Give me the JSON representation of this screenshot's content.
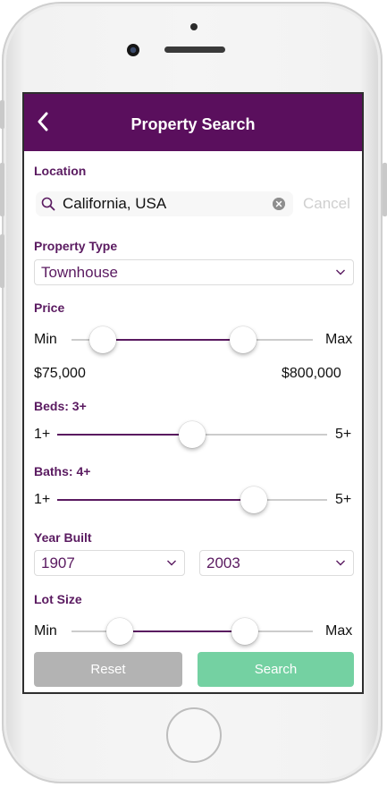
{
  "header": {
    "title": "Property Search"
  },
  "location": {
    "label": "Location",
    "value": "California, USA",
    "cancel": "Cancel"
  },
  "property_type": {
    "label": "Property Type",
    "value": "Townhouse"
  },
  "price": {
    "label": "Price",
    "min_label": "Min",
    "max_label": "Max",
    "min_value": "$75,000",
    "max_value": "$800,000",
    "range_fraction": [
      0.13,
      0.71
    ]
  },
  "beds": {
    "label": "Beds: 3+",
    "min_label": "1+",
    "max_label": "5+",
    "fraction": 0.5
  },
  "baths": {
    "label": "Baths: 4+",
    "min_label": "1+",
    "max_label": "5+",
    "fraction": 0.73
  },
  "year_built": {
    "label": "Year Built",
    "from": "1907",
    "to": "2003"
  },
  "lot_size": {
    "label": "Lot Size",
    "min_label": "Min",
    "max_label": "Max",
    "range_fraction": [
      0.2,
      0.72
    ]
  },
  "actions": {
    "reset": "Reset",
    "search": "Search"
  },
  "colors": {
    "primary": "#5a0f5d",
    "search_button": "#74d1a2",
    "reset_button": "#b3b3b3"
  }
}
